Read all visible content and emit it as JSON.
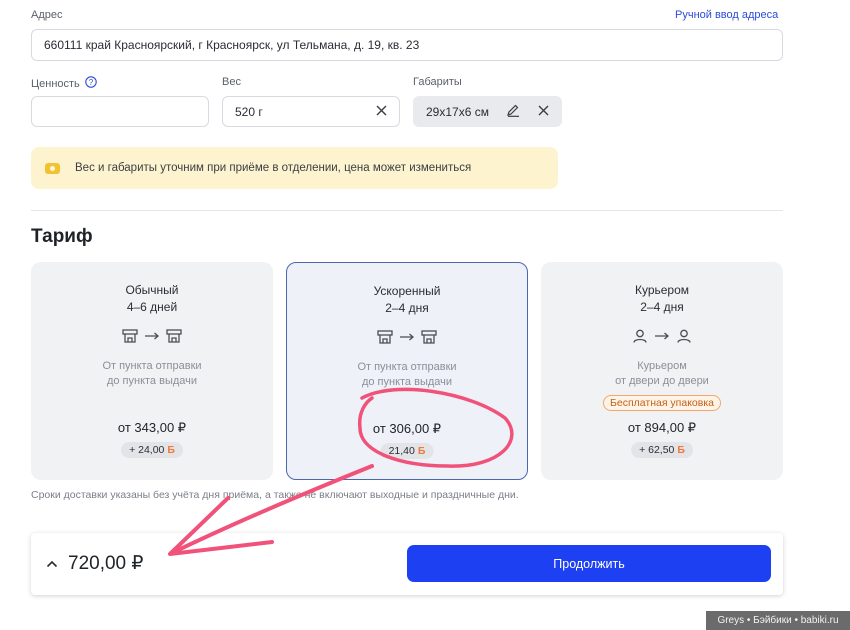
{
  "address": {
    "label": "Адрес",
    "manual_link": "Ручной ввод адреса",
    "value": "660111  край Красноярский, г Красноярск, ул Тельмана, д. 19, кв. 23"
  },
  "value_field": {
    "label": "Ценность",
    "value": ""
  },
  "weight_field": {
    "label": "Вес",
    "value": "520 г"
  },
  "dimensions_field": {
    "label": "Габариты",
    "value": "29x17x6 см"
  },
  "notice": "Вес и габариты уточним при приёме в отделении, цена может измениться",
  "tariff": {
    "title": "Тариф",
    "cards": [
      {
        "name": "Обычный",
        "days": "4–6 дней",
        "route_line1": "От пункта отправки",
        "route_line2": "до пункта выдачи",
        "badge": "",
        "price": "от 343,00 ₽",
        "bonus": "+ 24,00",
        "selected": false
      },
      {
        "name": "Ускоренный",
        "days": "2–4 дня",
        "route_line1": "От пункта отправки",
        "route_line2": "до пункта выдачи",
        "badge": "",
        "price": "от 306,00 ₽",
        "bonus": "21,40",
        "selected": true
      },
      {
        "name": "Курьером",
        "days": "2–4 дня",
        "route_line1": "Курьером",
        "route_line2": "от двери до двери",
        "badge": "Бесплатная упаковка",
        "price": "от 894,00 ₽",
        "bonus": "+ 62,50",
        "selected": false
      }
    ],
    "footnote": "Сроки доставки указаны без учёта дня приёма, а также не включают выходные и праздничные дни."
  },
  "bonus_symbol": "Б",
  "bottom": {
    "total": "720,00 ₽",
    "continue_label": "Продолжить"
  },
  "watermark": "Greys • Бэйбики • babiki.ru",
  "colors": {
    "accent": "#1c40f2",
    "selected_border": "#4a67b0",
    "annotation": "#f0527a"
  }
}
